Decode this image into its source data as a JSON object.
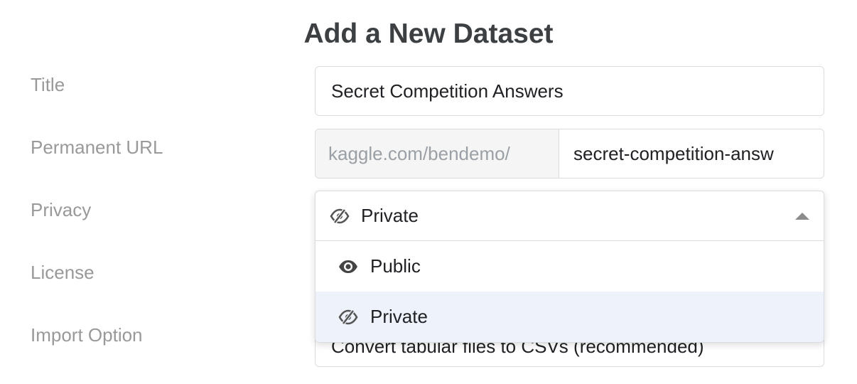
{
  "page": {
    "title": "Add a New Dataset"
  },
  "form": {
    "labels": {
      "title": "Title",
      "permanent_url": "Permanent URL",
      "privacy": "Privacy",
      "license": "License",
      "import_option": "Import Option"
    },
    "title_value": "Secret Competition Answers",
    "url_prefix": "kaggle.com/bendemo/",
    "url_slug": "secret-competition-answ",
    "privacy": {
      "selected": "Private",
      "selected_icon": "eye-slash-icon",
      "dropdown_open": true,
      "options": [
        {
          "label": "Public",
          "icon": "eye-icon",
          "highlighted": false
        },
        {
          "label": "Private",
          "icon": "eye-slash-icon",
          "highlighted": true
        }
      ]
    },
    "import_value": "Convert tabular files to CSVs (recommended)"
  },
  "colors": {
    "label_gray": "#999999",
    "border": "#dadce0",
    "prefix_bg": "#f5f5f5",
    "highlight_bg": "#eef3fb"
  }
}
